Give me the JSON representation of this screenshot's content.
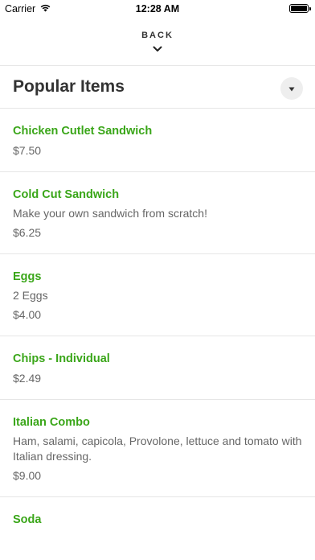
{
  "status_bar": {
    "carrier": "Carrier",
    "time": "12:28 AM"
  },
  "nav": {
    "back_label": "BACK"
  },
  "section": {
    "title": "Popular Items"
  },
  "items": [
    {
      "name": "Chicken Cutlet Sandwich",
      "description": "",
      "price": "$7.50"
    },
    {
      "name": "Cold Cut Sandwich",
      "description": "Make your own sandwich from scratch!",
      "price": "$6.25"
    },
    {
      "name": "Eggs",
      "description": "2 Eggs",
      "price": "$4.00"
    },
    {
      "name": "Chips - Individual",
      "description": "",
      "price": "$2.49"
    },
    {
      "name": "Italian Combo",
      "description": "Ham, salami, capicola, Provolone, lettuce and tomato with Italian dressing.",
      "price": "$9.00"
    },
    {
      "name": "Soda",
      "description": "",
      "price": ""
    }
  ],
  "colors": {
    "item_name": "#3aa619",
    "secondary_text": "#666666",
    "divider": "#e6e6e6"
  }
}
